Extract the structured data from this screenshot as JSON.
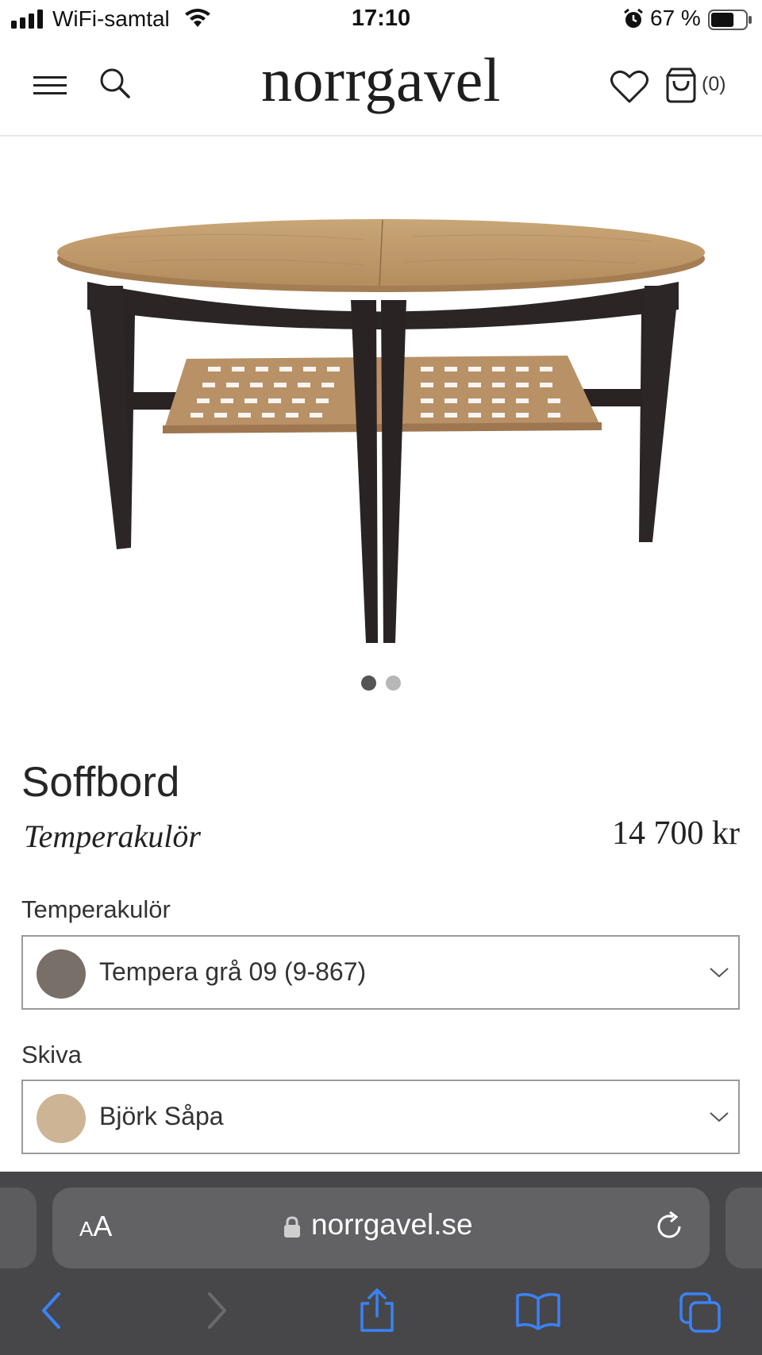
{
  "status_bar": {
    "carrier": "WiFi-samtal",
    "time": "17:10",
    "battery_text": "67 %",
    "battery_level": 0.67
  },
  "header": {
    "logo": "norrgavel",
    "cart_count": "(0)",
    "icons": [
      "menu-icon",
      "search-icon",
      "heart-icon",
      "shopping-bag-icon"
    ]
  },
  "gallery": {
    "current_index": 1,
    "total": 2,
    "colors": {
      "active": "#555555",
      "inactive": "#b7b7b7"
    }
  },
  "product": {
    "title": "Soffbord",
    "subtitle": "Temperakulör",
    "price": "14 700 kr"
  },
  "options": [
    {
      "label": "Temperakulör",
      "value": "Tempera grå 09 (9-867)",
      "swatch_color": "#787068"
    },
    {
      "label": "Skiva",
      "value": "Björk Såpa",
      "swatch_color": "#cdb494"
    }
  ],
  "browser": {
    "aa_small": "A",
    "aa_big": "A",
    "url": "norrgavel.se",
    "toolbar_icons": [
      "back-icon",
      "forward-icon",
      "share-icon",
      "bookmarks-icon",
      "tabs-icon"
    ],
    "accent": "#3a82f7"
  }
}
